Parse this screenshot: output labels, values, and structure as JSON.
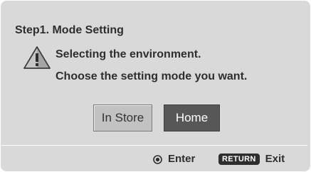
{
  "dialog": {
    "title": "Step1. Mode Setting",
    "warning_icon": "warning-triangle-icon",
    "message_line1": "Selecting the environment.",
    "message_line2": "Choose the setting mode you want."
  },
  "options": {
    "in_store_label": "In Store",
    "home_label": "Home",
    "selected": "Home"
  },
  "footer": {
    "enter_icon": "enter-circle-icon",
    "enter_label": "Enter",
    "return_badge": "RETURN",
    "exit_label": "Exit"
  },
  "colors": {
    "background": "#d9d9d9",
    "text": "#2e2e2e",
    "selected_button": "#575757",
    "unselected_button": "#c2c2c2"
  }
}
